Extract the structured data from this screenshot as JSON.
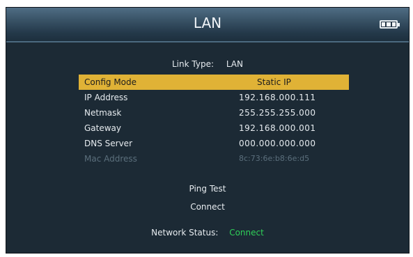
{
  "header": {
    "title": "LAN",
    "battery_icon": "battery-full-icon"
  },
  "link_type": {
    "label": "Link Type:",
    "value": "LAN"
  },
  "rows": [
    {
      "label": "Config Mode",
      "value": "Static IP",
      "selected": true
    },
    {
      "label": "IP Address",
      "value": "192.168.000.111"
    },
    {
      "label": "Netmask",
      "value": "255.255.255.000"
    },
    {
      "label": "Gateway",
      "value": "192.168.000.001"
    },
    {
      "label": "DNS Server",
      "value": "000.000.000.000"
    },
    {
      "label": "Mac Address",
      "value": "8c:73:6e:b8:6e:d5",
      "disabled": true
    }
  ],
  "actions": {
    "ping_test": "Ping Test",
    "connect": "Connect"
  },
  "network_status": {
    "label": "Network Status:",
    "value": "Connect"
  },
  "colors": {
    "selection": "#e0b236",
    "status_ok": "#2fcf58",
    "background": "#1c2a35"
  }
}
